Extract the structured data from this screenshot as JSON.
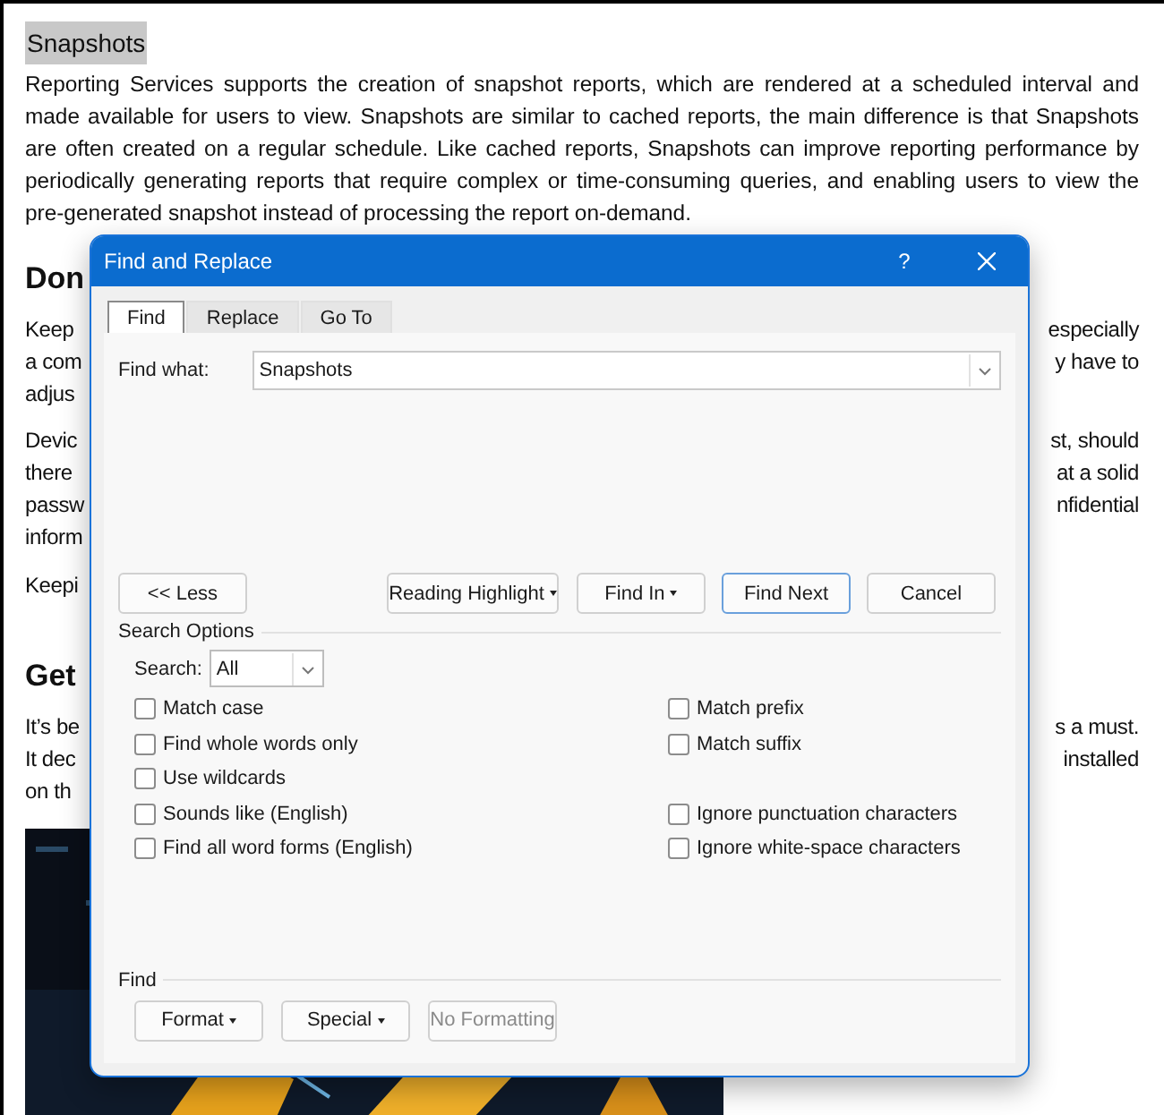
{
  "document": {
    "title": "Snapshots",
    "title_highlighted": true,
    "intro_lines": [
      "Reporting Services supports the creation of snapshot reports, which are rendered at a scheduled interval and",
      "made available for users to view. Snapshots are similar to cached reports, the main difference is that Snapshots",
      "are often created on a regular schedule. Like cached reports, Snapshots can improve reporting performance by",
      "periodically generating reports that require complex or time-consuming queries, and enabling users to view the",
      "pre-generated snapshot instead of processing the report on-demand."
    ],
    "blocks": [
      {
        "kind": "heading",
        "left": "Don"
      },
      {
        "kind": "line",
        "left": "Keep",
        "right": "especially"
      },
      {
        "kind": "line",
        "left": "a com",
        "right": "y have to"
      },
      {
        "kind": "last",
        "left": "adjus"
      },
      {
        "kind": "line",
        "left": "Devic",
        "right": "st, should"
      },
      {
        "kind": "line",
        "left": "there",
        "right": "at a solid"
      },
      {
        "kind": "line",
        "left": "passw",
        "right": "nfidential"
      },
      {
        "kind": "last",
        "left": "inform"
      },
      {
        "kind": "last",
        "left": "Keepi"
      },
      {
        "kind": "heading",
        "left": "Get"
      },
      {
        "kind": "line",
        "left": "It’s be",
        "right": "s a must."
      },
      {
        "kind": "line",
        "left": "It dec",
        "right": "installed"
      },
      {
        "kind": "last",
        "left": "on th"
      }
    ]
  },
  "dialog": {
    "title": "Find and Replace",
    "help": "?",
    "tabs": [
      {
        "label": "Find",
        "selected": true
      },
      {
        "label": "Replace",
        "selected": false
      },
      {
        "label": "Go To",
        "selected": false
      }
    ],
    "find_what": {
      "label": "Find what:",
      "value": "Snapshots"
    },
    "buttons": [
      {
        "label": "<< Less",
        "has_menu": false,
        "default": false
      },
      {
        "label": "Reading Highlight",
        "has_menu": true,
        "default": false
      },
      {
        "label": "Find In",
        "has_menu": true,
        "default": false
      },
      {
        "label": "Find Next",
        "has_menu": false,
        "default": true
      },
      {
        "label": "Cancel",
        "has_menu": false,
        "default": false
      }
    ],
    "search_options": {
      "title": "Search Options",
      "search_label": "Search:",
      "search_value": "All",
      "rows": [
        {
          "left": {
            "label": "Match case",
            "checked": false
          },
          "right": {
            "label": "Match prefix",
            "checked": false
          }
        },
        {
          "left": {
            "label": "Find whole words only",
            "checked": false
          },
          "right": {
            "label": "Match suffix",
            "checked": false
          }
        },
        {
          "left": {
            "label": "Use wildcards",
            "checked": false
          }
        },
        {
          "left": {
            "label": "Sounds like (English)",
            "checked": false
          },
          "right": {
            "label": "Ignore punctuation characters",
            "checked": false
          }
        },
        {
          "left": {
            "label": "Find all word forms (English)",
            "checked": false
          },
          "right": {
            "label": "Ignore white-space characters",
            "checked": false
          }
        }
      ]
    },
    "find_section": {
      "title": "Find",
      "buttons": [
        {
          "label": "Format",
          "has_menu": true,
          "disabled": false
        },
        {
          "label": "Special",
          "has_menu": true,
          "disabled": false
        },
        {
          "label": "No Formatting",
          "has_menu": false,
          "disabled": true
        }
      ]
    }
  }
}
